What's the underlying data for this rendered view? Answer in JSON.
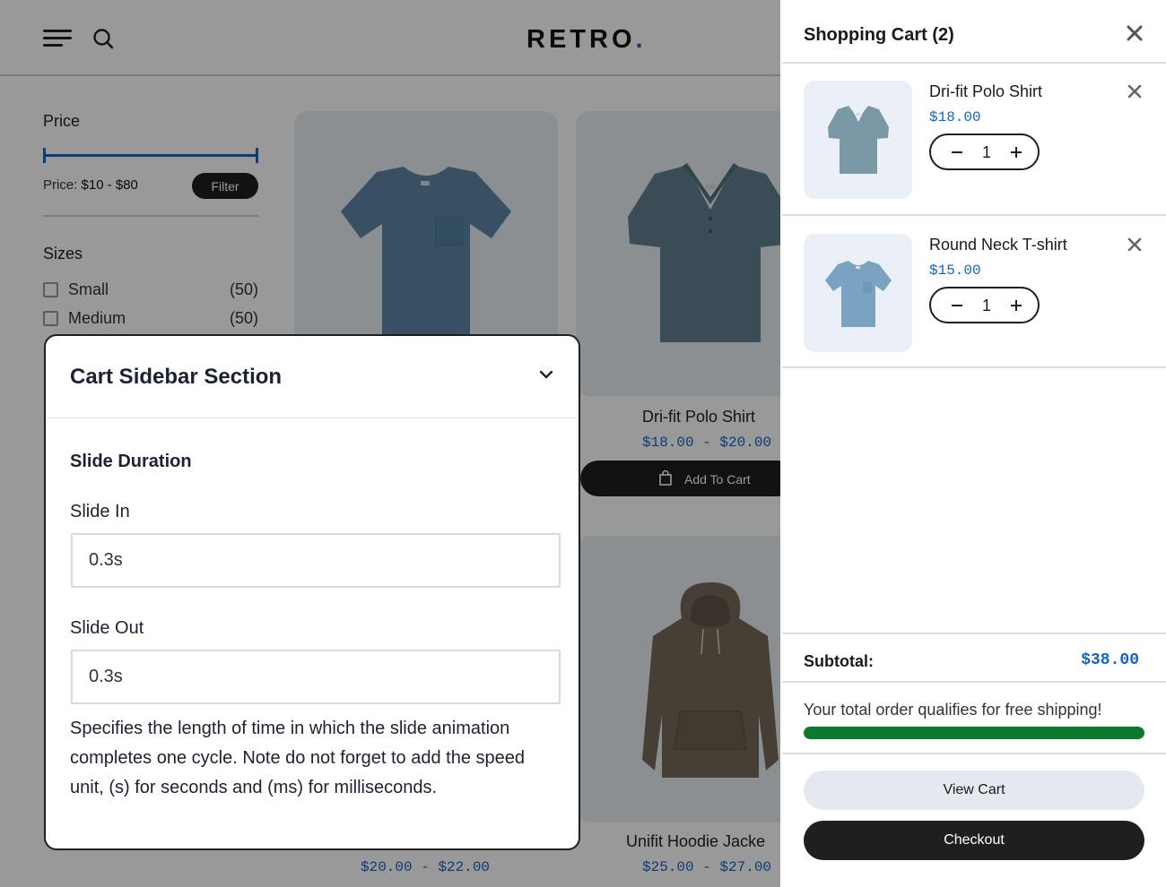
{
  "store": {
    "logo_text": "RETRO",
    "logo_dot": ".",
    "icons": {
      "menu": "hamburger-menu-icon",
      "search": "search-icon"
    },
    "filters": {
      "price_title": "Price",
      "price_prefix": "Price:",
      "price_range": "$10 - $80",
      "filter_button": "Filter",
      "sizes_title": "Sizes",
      "sizes": [
        {
          "label": "Small",
          "count": "(50)"
        },
        {
          "label": "Medium",
          "count": "(50)"
        }
      ]
    },
    "products": [
      {
        "name": "Dri-fit Polo Shirt",
        "price": "$18.00 - $20.00",
        "add_to_cart": "Add To Cart"
      },
      {
        "price": "$20.00 - $22.00"
      },
      {
        "name": "Unifit Hoodie Jacke",
        "price": "$25.00 - $27.00"
      }
    ]
  },
  "settings": {
    "section_title": "Cart Sidebar Section",
    "group_title": "Slide Duration",
    "slide_in_label": "Slide In",
    "slide_in_value": "0.3s",
    "slide_out_label": "Slide Out",
    "slide_out_value": "0.3s",
    "help_text": "Specifies the length of time in which the slide animation completes one cycle. Note do not forget to add the speed unit, (s) for seconds and (ms) for milliseconds."
  },
  "cart": {
    "title": "Shopping Cart (2)",
    "items": [
      {
        "name": "Dri-fit Polo Shirt",
        "price": "$18.00",
        "qty": "1"
      },
      {
        "name": "Round Neck T-shirt",
        "price": "$15.00",
        "qty": "1"
      }
    ],
    "subtotal_label": "Subtotal:",
    "subtotal_value": "$38.00",
    "shipping_message": "Your total order qualifies for free shipping!",
    "shipping_progress": 1.0,
    "view_cart": "View Cart",
    "checkout": "Checkout"
  },
  "colors": {
    "accent_blue": "#1565c0",
    "progress_green": "#0a7a2c",
    "dark_button": "#1f1f1f",
    "light_button": "#e5e8ee",
    "product_bg": "#e9eef4"
  }
}
